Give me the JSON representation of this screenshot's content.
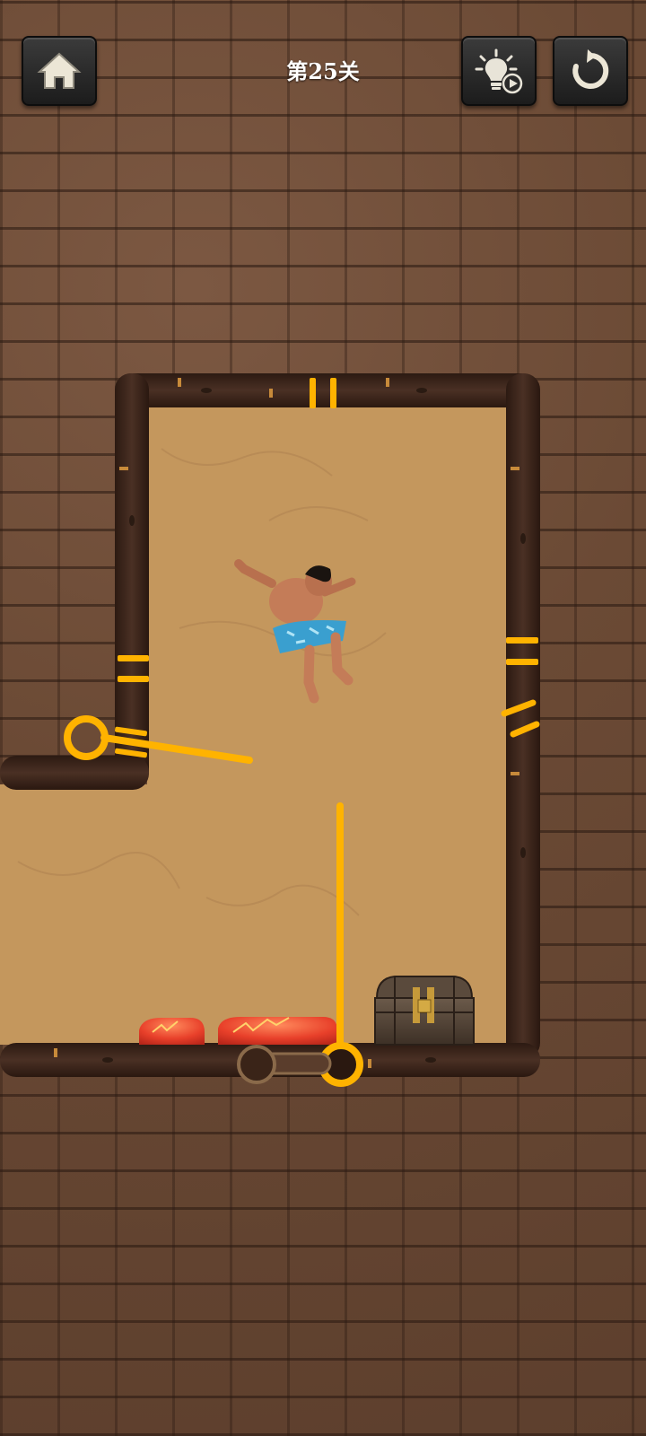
{
  "hud": {
    "level_title": "第25关"
  },
  "buttons": {
    "home": "home-icon",
    "hint": "lightbulb-video-icon",
    "restart": "restart-icon"
  },
  "colors": {
    "pin": "#ffc107",
    "sand": "#c4975d",
    "log": "#3e261c",
    "lava": "#e8402a"
  },
  "objects": {
    "character": "hero-character",
    "treasure": "treasure-chest",
    "hazard": "lava-pool"
  }
}
